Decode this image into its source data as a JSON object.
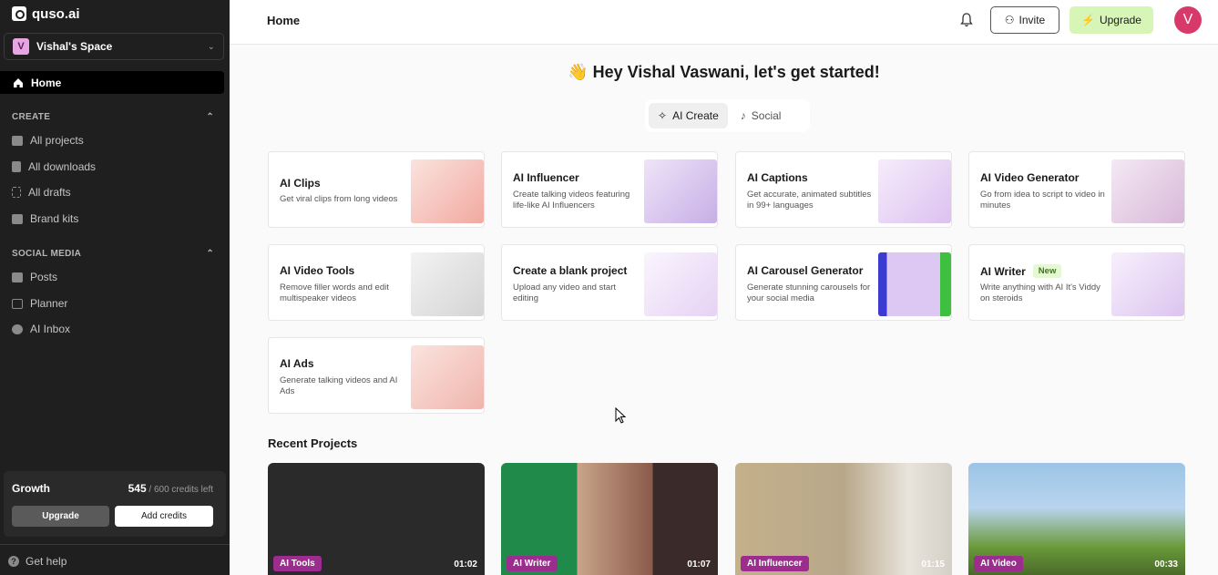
{
  "app": {
    "logo_text": "quso.ai"
  },
  "sidebar": {
    "space_initial": "V",
    "space_name": "Vishal's Space",
    "home_label": "Home",
    "create_section": "CREATE",
    "create_items": [
      {
        "label": "All projects",
        "icon": "folder-icon"
      },
      {
        "label": "All downloads",
        "icon": "download-icon"
      },
      {
        "label": "All drafts",
        "icon": "draft-icon"
      },
      {
        "label": "Brand kits",
        "icon": "brand-kit-icon"
      }
    ],
    "social_section": "SOCIAL MEDIA",
    "social_items": [
      {
        "label": "Posts",
        "icon": "posts-icon"
      },
      {
        "label": "Planner",
        "icon": "calendar-icon"
      },
      {
        "label": "AI Inbox",
        "icon": "inbox-icon"
      }
    ],
    "plan_name": "Growth",
    "credits_used": "545",
    "credits_total": "/ 600 credits left",
    "upgrade_label": "Upgrade",
    "add_credits_label": "Add credits",
    "help_label": "Get help"
  },
  "header": {
    "title": "Home",
    "invite_label": "Invite",
    "upgrade_label": "Upgrade",
    "avatar_initial": "V"
  },
  "main": {
    "greeting": "👋 Hey Vishal Vaswani, let's get started!",
    "tabs": [
      {
        "label": "AI Create",
        "active": true
      },
      {
        "label": "Social",
        "active": false
      }
    ],
    "cards": [
      {
        "title": "AI Clips",
        "desc": "Get viral clips from long videos",
        "accent": "#f5c6c0"
      },
      {
        "title": "AI Influencer",
        "desc": "Create talking videos featuring life-like AI Influencers",
        "accent": "#d7c3ee"
      },
      {
        "title": "AI Captions",
        "desc": "Get accurate, animated subtitles in 99+ languages",
        "accent": "#e9d6f5"
      },
      {
        "title": "AI Video Generator",
        "desc": "Go from idea to script to video in minutes",
        "accent": "#ead6ea"
      },
      {
        "title": "AI Video Tools",
        "desc": "Remove filler words and edit multispeaker videos",
        "accent": "#e4e4e4"
      },
      {
        "title": "Create a blank project",
        "desc": "Upload any video and start editing",
        "accent": "#efe3f7"
      },
      {
        "title": "AI Carousel Generator",
        "desc": "Generate stunning carousels for your social media",
        "accent": "#dfd0f0"
      },
      {
        "title": "AI Writer",
        "badge": "New",
        "desc": "Write anything with AI It's Viddy on steroids",
        "accent": "#ead9f5"
      },
      {
        "title": "AI Ads",
        "desc": "Generate talking videos and AI Ads",
        "accent": "#f6d2cc"
      }
    ],
    "recent_title": "Recent Projects",
    "projects": [
      {
        "tag": "AI Tools",
        "duration": "01:02",
        "bg": "#2a2a2a"
      },
      {
        "tag": "AI Writer",
        "duration": "01:07",
        "bg": "#1f8a4a"
      },
      {
        "tag": "AI Influencer",
        "duration": "01:15",
        "bg": "#b8a88a"
      },
      {
        "tag": "AI Video",
        "duration": "00:33",
        "bg": "#8ab2d6"
      }
    ]
  }
}
